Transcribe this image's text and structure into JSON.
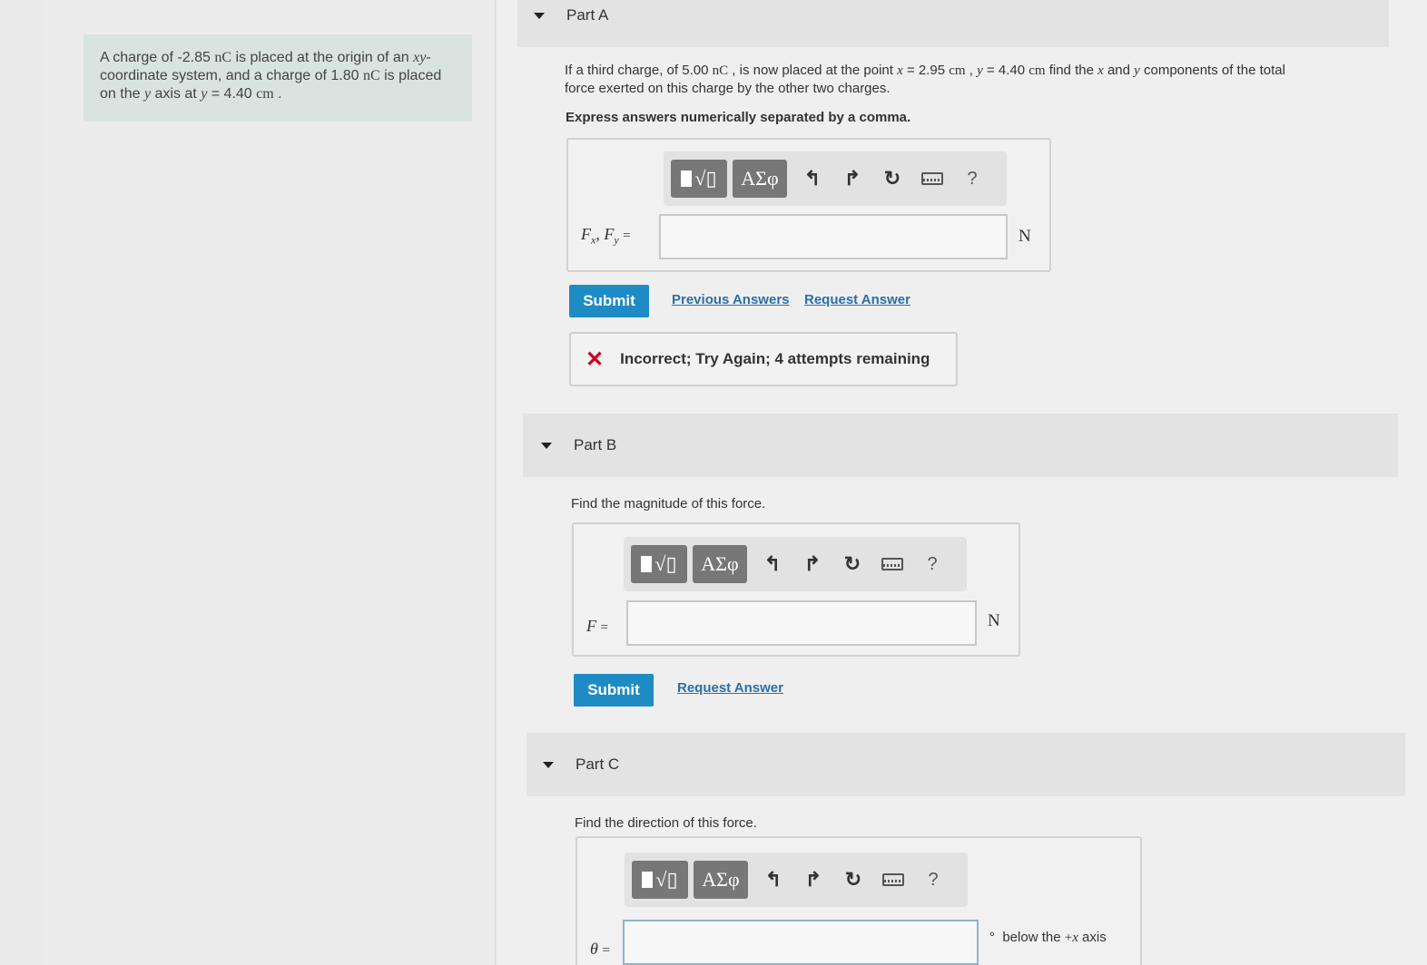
{
  "problem": {
    "text_1": "A charge of -2.85",
    "unit_nc": "nC",
    "text_2": "is placed at the origin of an",
    "xy": "xy",
    "text_3": "-coordinate system, and a charge of 1.80",
    "text_4": "is placed on the",
    "y_var": "y",
    "text_5": "axis at",
    "y_eq": "y",
    "text_6": "= 4.40",
    "cm": "cm",
    "dot": "."
  },
  "part_a": {
    "title": "Part A",
    "question_1": "If a third charge, of 5.00",
    "question_nc": "nC",
    "question_2": ", is now placed at the point",
    "x_var": "x",
    "question_3": "= 2.95",
    "cm_1": "cm",
    "question_4": ",",
    "y_var": "y",
    "question_5": "= 4.40",
    "cm_2": "cm",
    "question_6": "find the",
    "x_var2": "x",
    "question_7": "and",
    "y_var2": "y",
    "question_8": "components of the total",
    "question_line2": "force exerted on this charge by the other two charges.",
    "instruction": "Express answers numerically separated by a comma.",
    "label": "F",
    "label_sub_x": "x",
    "label_sep": ",",
    "label_2": "F",
    "label_sub_y": "y",
    "label_eq": "=",
    "unit": "N",
    "submit": "Submit",
    "previous_answers": "Previous Answers",
    "request_answer": "Request Answer",
    "feedback": "Incorrect; Try Again; 4 attempts remaining"
  },
  "part_b": {
    "title": "Part B",
    "question": "Find the magnitude of this force.",
    "label": "F",
    "label_eq": "=",
    "unit": "N",
    "submit": "Submit",
    "request_answer": "Request Answer"
  },
  "part_c": {
    "title": "Part C",
    "question": "Find the direction of this force.",
    "label": "θ",
    "label_eq": "=",
    "degree": "°",
    "unit_text": "below the",
    "unit_plus": "+",
    "unit_x": "x",
    "unit_axis": "axis"
  },
  "toolbar": {
    "greek": "ΑΣφ",
    "undo": "↰",
    "redo": "↱",
    "reset": "↻",
    "help": "?"
  },
  "colors": {
    "accent": "#1f8bc4",
    "error": "#d0021b",
    "problem_bg": "#d9e3df"
  }
}
